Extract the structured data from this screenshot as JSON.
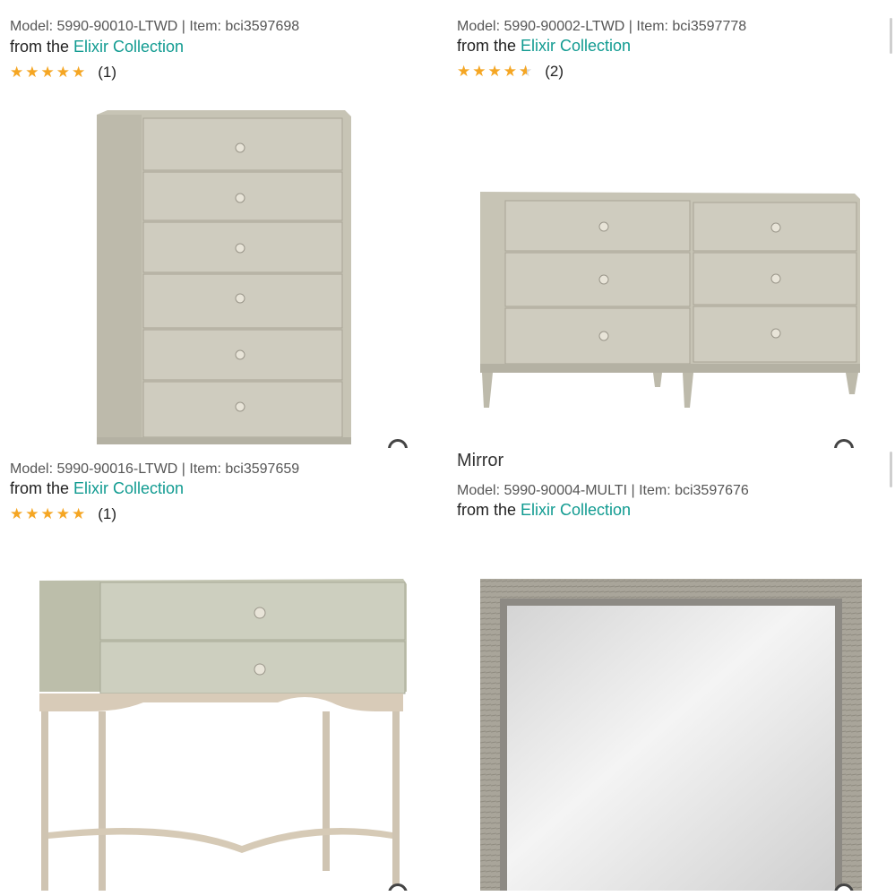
{
  "products": [
    {
      "title": "",
      "model_line": "Model: 5990-90010-LTWD | Item: bci3597698",
      "from_prefix": "from the ",
      "collection": "Elixir Collection",
      "stars": "★★★★★",
      "rating_value": 5,
      "review_count": "(1)",
      "image": "tall-chest-image"
    },
    {
      "title": "",
      "model_line": "Model: 5990-90002-LTWD | Item: bci3597778",
      "from_prefix": "from the ",
      "collection": "Elixir Collection",
      "stars": "★★★★",
      "rating_value": 4.5,
      "review_count": "(2)",
      "image": "dresser-image"
    },
    {
      "title": "",
      "model_line": "Model: 5990-90016-LTWD | Item: bci3597659",
      "from_prefix": "from the ",
      "collection": "Elixir Collection",
      "stars": "★★★★★",
      "rating_value": 5,
      "review_count": "(1)",
      "image": "nightstand-image"
    },
    {
      "title": "Mirror",
      "model_line": "Model: 5990-90004-MULTI | Item: bci3597676",
      "from_prefix": "from the ",
      "collection": "Elixir Collection",
      "image": "mirror-image"
    }
  ],
  "colors": {
    "link": "#119b91",
    "star": "#f5a623",
    "wood": "#c9c6b8"
  }
}
